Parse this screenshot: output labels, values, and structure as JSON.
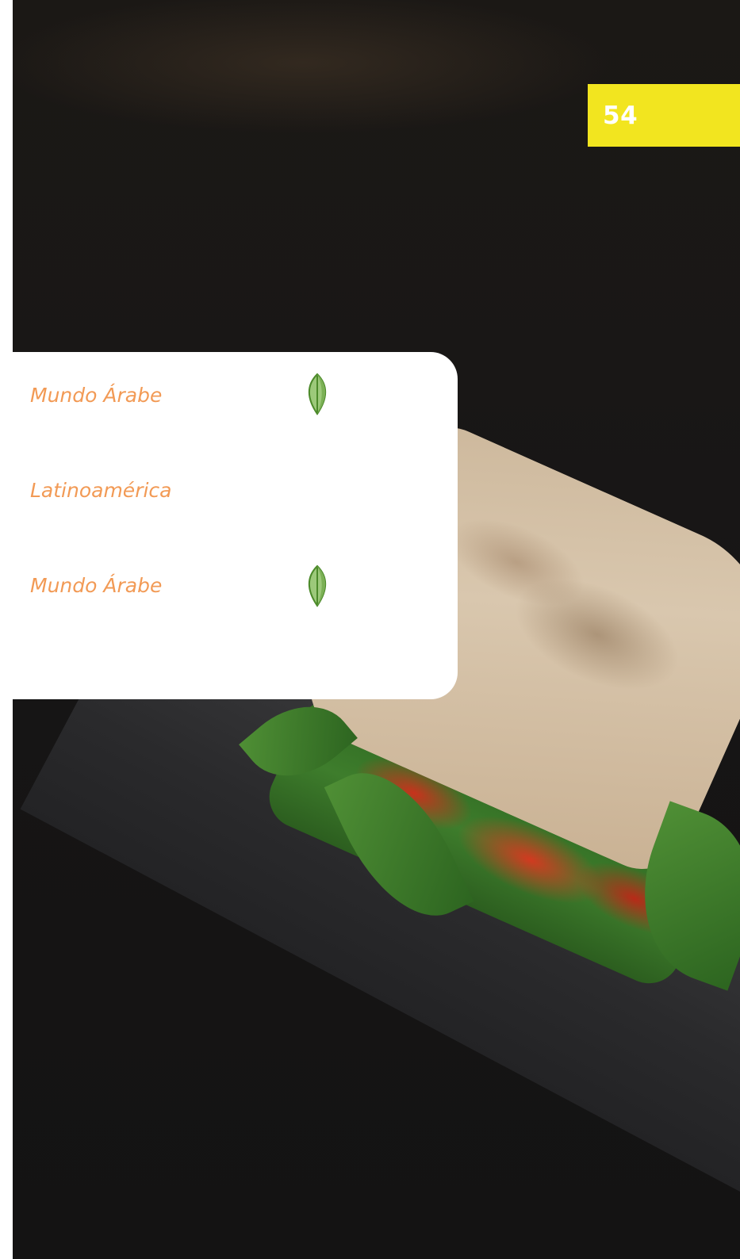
{
  "page": {
    "number": "54",
    "badge_color": "#f2e51f"
  },
  "menu": {
    "label_color": "#f29a55",
    "items": [
      {
        "label": "Mundo Árabe",
        "icon": "leaf-icon"
      },
      {
        "label": "Latinoamérica",
        "icon": ""
      },
      {
        "label": "Mundo Árabe",
        "icon": "leaf-icon"
      }
    ]
  },
  "background": {
    "subject": "sandwich-photo"
  }
}
